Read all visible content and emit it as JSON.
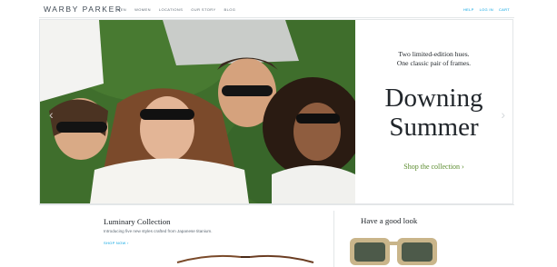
{
  "header": {
    "logo": "WARBY PARKER",
    "nav": [
      "Men",
      "Women",
      "Locations",
      "Our story",
      "Blog"
    ],
    "util": [
      "Help",
      "Log in",
      "Cart"
    ]
  },
  "hero": {
    "subtitle_line1": "Two limited-edition hues.",
    "subtitle_line2": "One classic pair of frames.",
    "title_line1": "Downing",
    "title_line2": "Summer",
    "cta": "Shop the collection ›",
    "arrow_left": "‹",
    "arrow_right": "›"
  },
  "cards": {
    "luminary": {
      "title": "Luminary Collection",
      "description": "Introducing five new styles crafted from Japanese titanium.",
      "link": "Shop now ›"
    },
    "good_look": {
      "title": "Have a good look"
    }
  },
  "colors": {
    "accent_link": "#00a2e1",
    "cta_green": "#5b8c2e",
    "text_dark": "#21262b"
  }
}
